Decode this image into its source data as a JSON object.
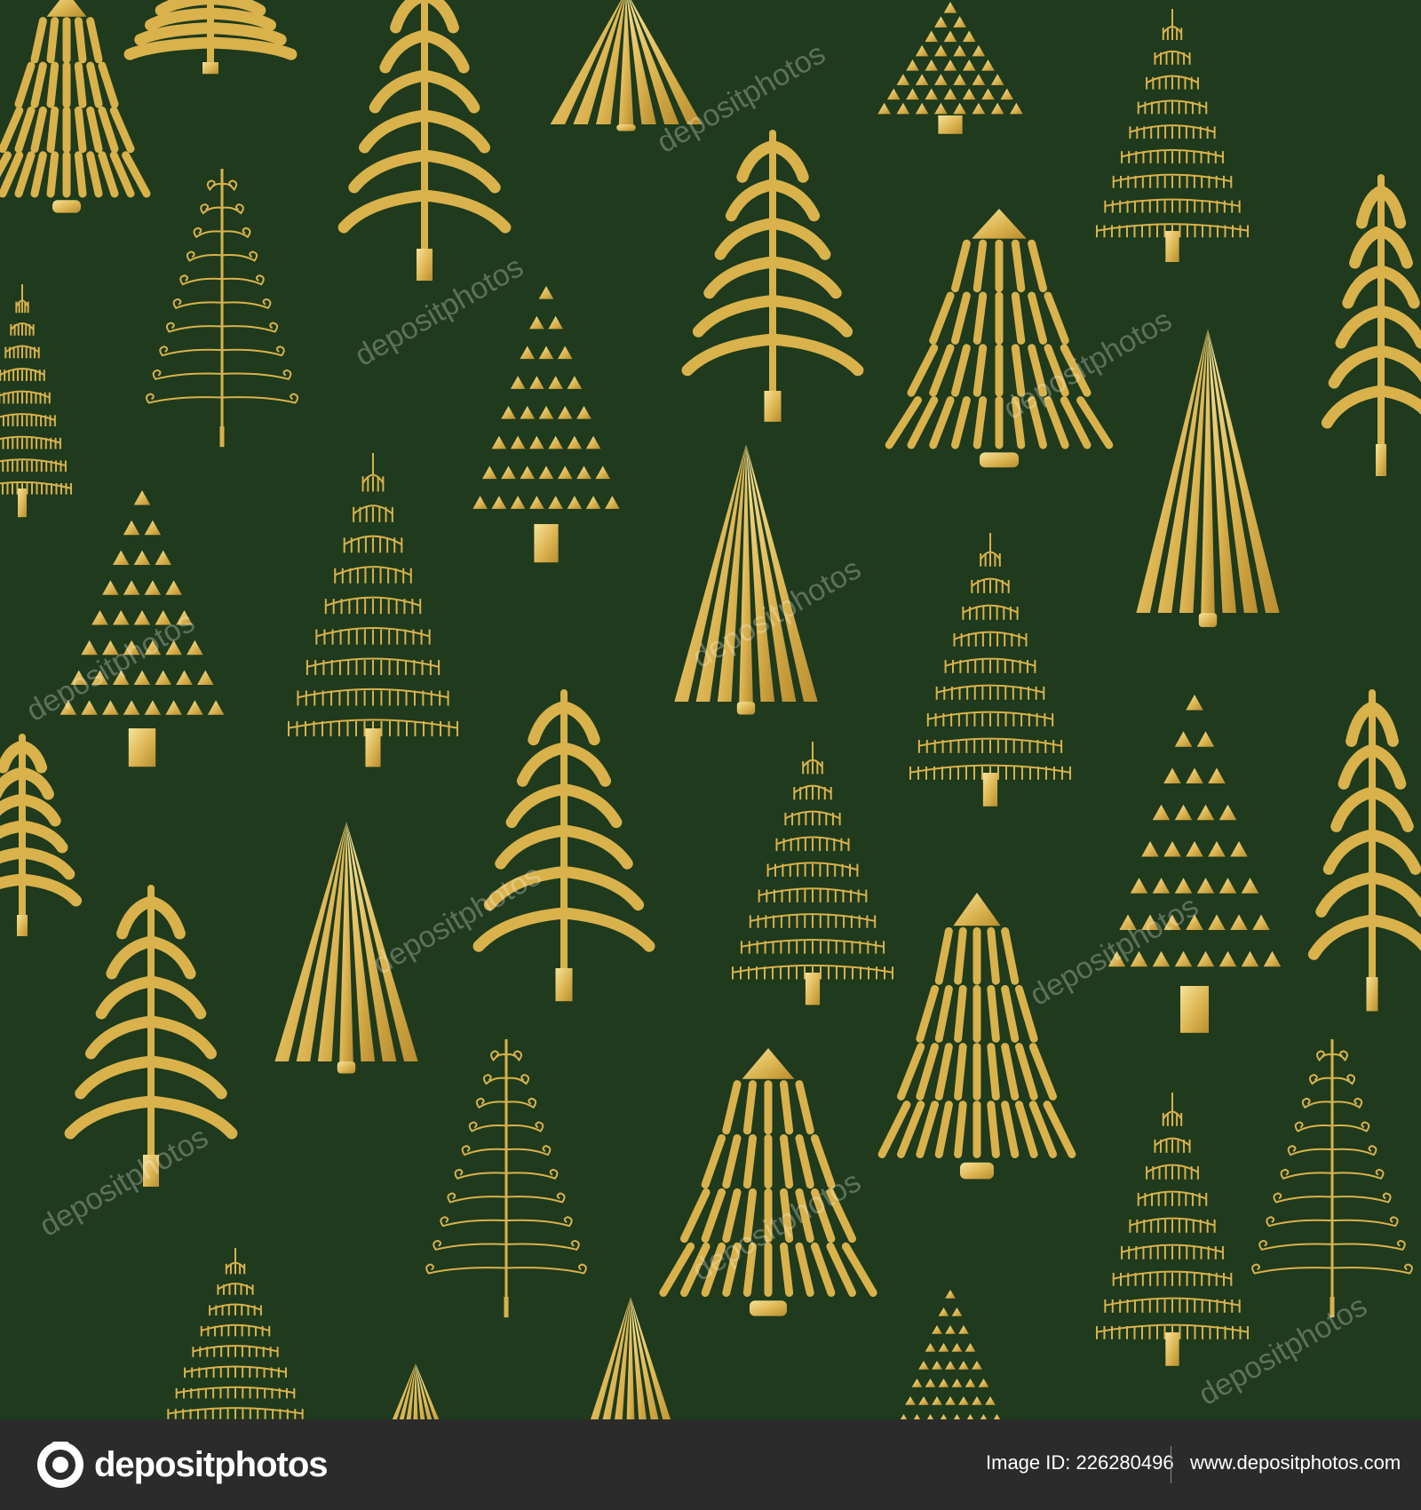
{
  "colors": {
    "background": "#1f3a1c",
    "gold_light": "#f3dc8c",
    "gold": "#d9b24c",
    "gold_dark": "#b98d2e",
    "footer": "#2b2b2b",
    "watermark": "#ffffff"
  },
  "pattern": {
    "tree_styles": [
      "triangle-dots-tree",
      "vertical-stripes-tree",
      "drooping-branches-tree",
      "scalloped-tiers-tree",
      "fine-lines-tree",
      "swirl-tree"
    ]
  },
  "watermark": {
    "text": "depositphotos"
  },
  "footer": {
    "brand": "depositphotos",
    "image_id": "Image ID: 226280496",
    "url": "www.depositphotos.com",
    "logo_icon": "camera-aperture-icon"
  }
}
